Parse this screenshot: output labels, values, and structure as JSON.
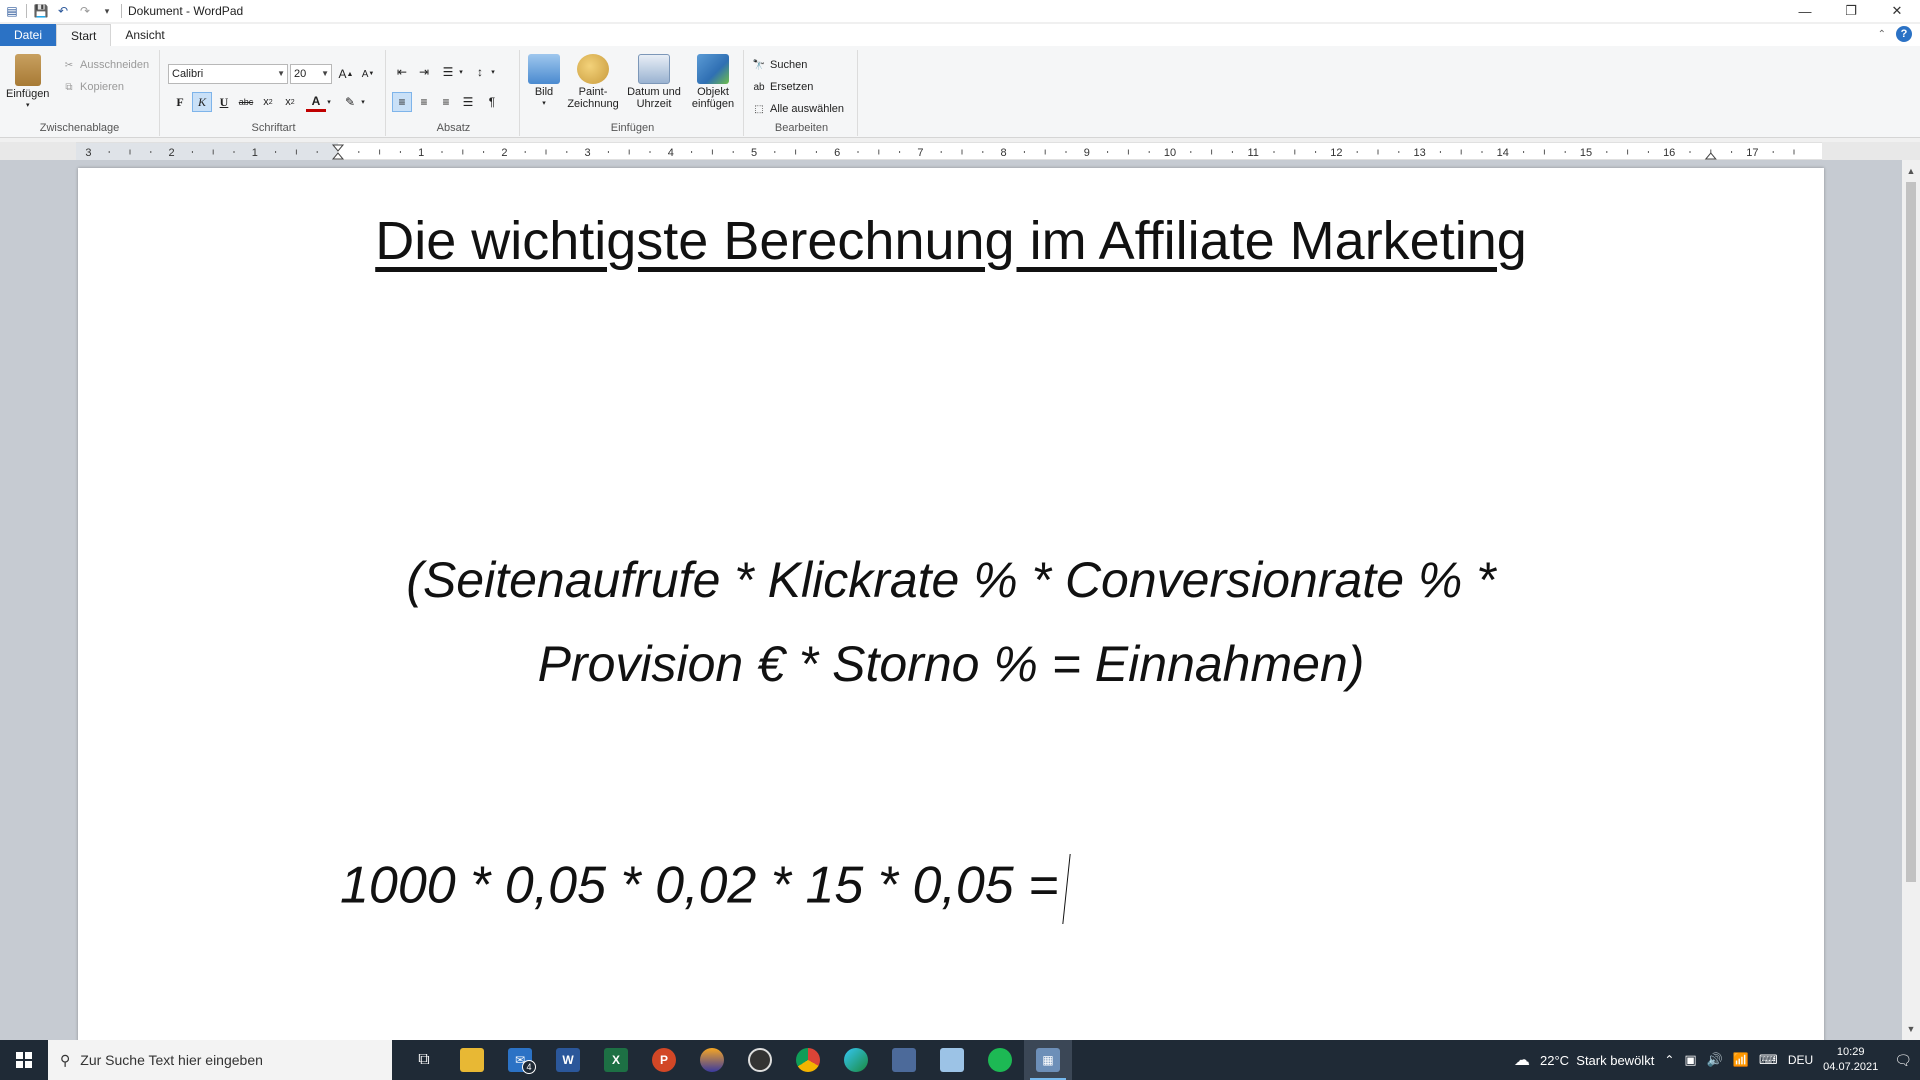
{
  "window": {
    "title": "Dokument - WordPad",
    "minimize_icon": "minimize-icon",
    "maximize_icon": "restore-icon",
    "close_icon": "close-icon"
  },
  "tabs": [
    {
      "label": "Datei"
    },
    {
      "label": "Start"
    },
    {
      "label": "Ansicht"
    }
  ],
  "ribbon": {
    "clipboard": {
      "label": "Zwischenablage",
      "paste": "Einfügen",
      "cut": "Ausschneiden",
      "copy": "Kopieren"
    },
    "font": {
      "label": "Schriftart",
      "family": "Calibri",
      "size": "20",
      "bold": "F",
      "italic": "K",
      "underline": "U",
      "strike": "abc"
    },
    "paragraph": {
      "label": "Absatz"
    },
    "insert": {
      "label": "Einfügen",
      "picture": "Bild",
      "paint_1": "Paint-",
      "paint_2": "Zeichnung",
      "datetime_1": "Datum und",
      "datetime_2": "Uhrzeit",
      "object_1": "Objekt",
      "object_2": "einfügen"
    },
    "edit": {
      "label": "Bearbeiten",
      "find": "Suchen",
      "replace": "Ersetzen",
      "select_all": "Alle auswählen"
    }
  },
  "ruler": {
    "left_labels": [
      "3",
      "2",
      "1"
    ],
    "right_labels": [
      "1",
      "2",
      "3",
      "4",
      "5",
      "6",
      "7",
      "8",
      "9",
      "10",
      "11",
      "12",
      "13",
      "14",
      "15",
      "16",
      "17"
    ]
  },
  "document": {
    "title": "Die wichtigste Berechnung im Affiliate Marketing",
    "formula_line1": "(Seitenaufrufe * Klickrate % * Conversionrate % *",
    "formula_line2": "Provision € * Storno % = Einnahmen)",
    "calculation": "1000 * 0,05 * 0,02 * 15 * 0,05 ="
  },
  "taskbar": {
    "search_placeholder": "Zur Suche Text hier eingeben",
    "mail_badge": "4",
    "weather": "22°C  Stark bewölkt",
    "language": "DEU",
    "time": "10:29",
    "date": "04.07.2021",
    "colors": {
      "word": "#2b579a",
      "excel": "#1d7044",
      "powerpoint": "#d24726",
      "spotify": "#1db954"
    }
  }
}
